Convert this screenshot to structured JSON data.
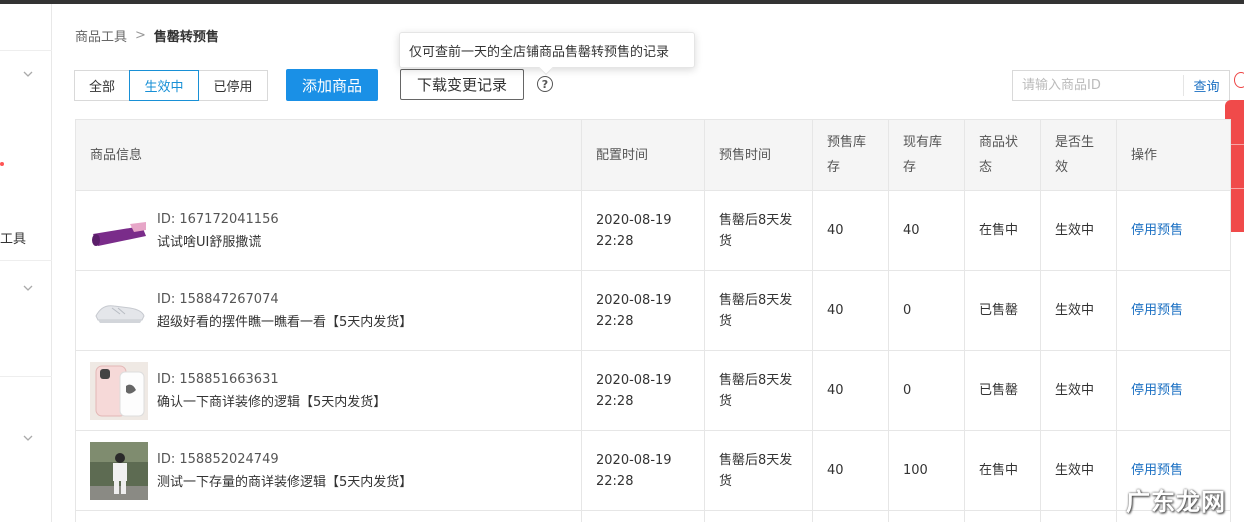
{
  "breadcrumb": {
    "parent": "商品工具",
    "separator": ">",
    "current": "售罄转预售"
  },
  "tooltip": {
    "text": "仅可查前一天的全店铺商品售罄转预售的记录"
  },
  "filters": [
    {
      "label": "全部",
      "active": false
    },
    {
      "label": "生效中",
      "active": true
    },
    {
      "label": "已停用",
      "active": false
    }
  ],
  "buttons": {
    "add": "添加商品",
    "download": "下载变更记录",
    "help": "?"
  },
  "search": {
    "placeholder": "请输入商品ID",
    "button": "查询"
  },
  "sidebar": {
    "tool_label": "工具"
  },
  "table": {
    "headers": {
      "product": "商品信息",
      "config_time": "配置时间",
      "presale_time": "预售时间",
      "presale_stock": "预售库存",
      "current_stock": "现有库存",
      "status": "商品状态",
      "effective": "是否生效",
      "operation": "操作"
    },
    "rows": [
      {
        "id": "ID: 167172041156",
        "name": "试试啥UI舒服撒谎",
        "config_date": "2020-08-19",
        "config_time": "22:28",
        "presale": "售罄后8天发货",
        "presale_stock": "40",
        "current_stock": "40",
        "status": "在售中",
        "effective": "生效中",
        "op": "停用预售",
        "thumb": "yoga-mat-image"
      },
      {
        "id": "ID: 158847267074",
        "name": "超级好看的摆件瞧一瞧看一看【5天内发货】",
        "config_date": "2020-08-19",
        "config_time": "22:28",
        "presale": "售罄后8天发货",
        "presale_stock": "40",
        "current_stock": "0",
        "status": "已售罄",
        "effective": "生效中",
        "op": "停用预售",
        "thumb": "sneaker-image"
      },
      {
        "id": "ID: 158851663631",
        "name": "确认一下商详装修的逻辑【5天内发货】",
        "config_date": "2020-08-19",
        "config_time": "22:28",
        "presale": "售罄后8天发货",
        "presale_stock": "40",
        "current_stock": "0",
        "status": "已售罄",
        "effective": "生效中",
        "op": "停用预售",
        "thumb": "phone-case-image"
      },
      {
        "id": "ID: 158852024749",
        "name": "测试一下存量的商详装修逻辑【5天内发货】",
        "config_date": "2020-08-19",
        "config_time": "22:28",
        "presale": "售罄后8天发货",
        "presale_stock": "40",
        "current_stock": "100",
        "status": "在售中",
        "effective": "生效中",
        "op": "停用预售",
        "thumb": "person-photo-image"
      }
    ]
  },
  "watermark": "广东龙网",
  "colors": {
    "primary": "#1a90e6",
    "link": "#1a6fc2",
    "float_bar": "#f04a4a"
  }
}
